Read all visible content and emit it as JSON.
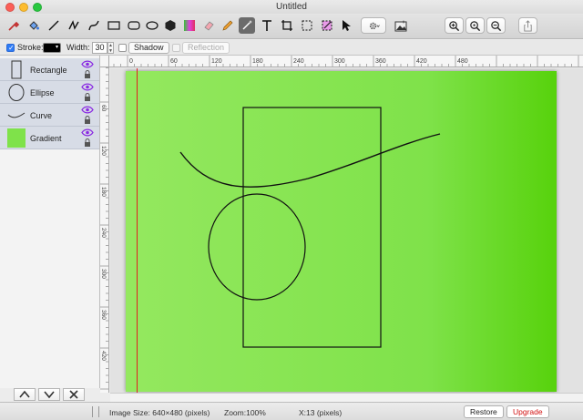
{
  "window": {
    "title": "Untitled"
  },
  "options": {
    "stroke_label": "Stroke:",
    "stroke_checked": true,
    "stroke_color": "#000000",
    "width_label": "Width:",
    "width_value": "30",
    "shadow_label": "Shadow",
    "reflection_label": "Reflection"
  },
  "layers": [
    {
      "name": "Rectangle",
      "thumb": "rectangle-icon"
    },
    {
      "name": "Ellipse",
      "thumb": "ellipse-icon"
    },
    {
      "name": "Curve",
      "thumb": "curve-icon"
    },
    {
      "name": "Gradient",
      "thumb": "gradient-swatch",
      "color": "#7fe24a"
    }
  ],
  "rulers": {
    "horizontal": [
      "0",
      "60",
      "120",
      "180",
      "240",
      "300",
      "360",
      "420",
      "480"
    ],
    "vertical": [
      "60",
      "120",
      "180",
      "240",
      "300",
      "360",
      "420"
    ]
  },
  "status": {
    "image_size": "Image Size: 640×480 (pixels)",
    "zoom": "Zoom:100%",
    "cursor": "X:13 (pixels)",
    "restore_label": "Restore",
    "upgrade_label": "Upgrade"
  },
  "colors": {
    "accent": "#2f7cf6",
    "canvas_green": "#7fe24a",
    "guide_red": "#e02020",
    "upgrade_red": "#d21010"
  }
}
